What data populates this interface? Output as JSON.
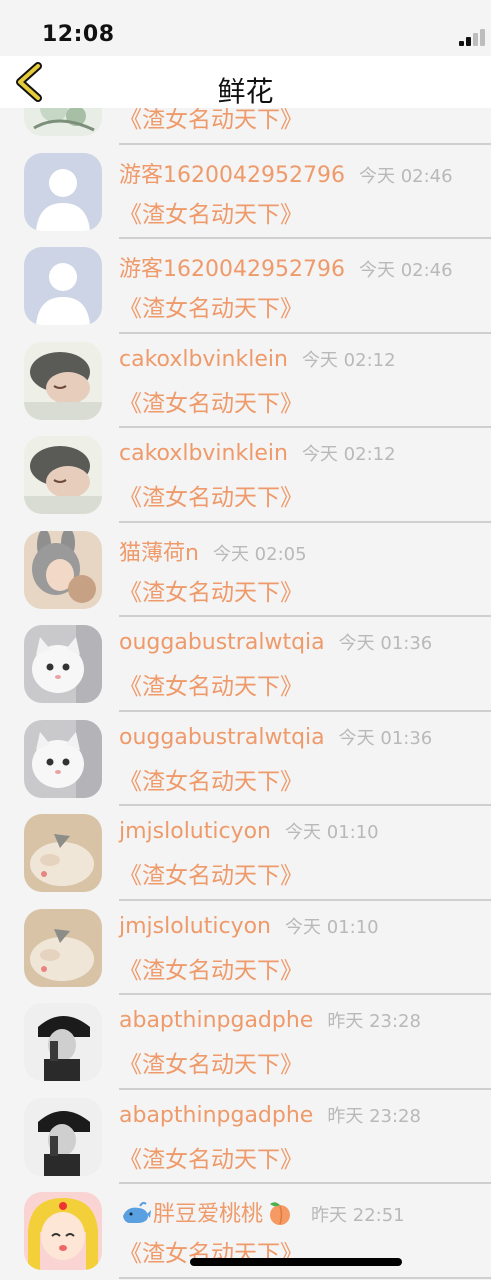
{
  "status_bar": {
    "time": "12:08"
  },
  "nav": {
    "title": "鲜花"
  },
  "rows": [
    {
      "username": "",
      "timestamp": "",
      "message": "《渣女名动天下》",
      "avatar": "blossom"
    },
    {
      "username": "游客1620042952796",
      "timestamp": "今天 02:46",
      "message": "《渣女名动天下》",
      "avatar": "default"
    },
    {
      "username": "游客1620042952796",
      "timestamp": "今天 02:46",
      "message": "《渣女名动天下》",
      "avatar": "default"
    },
    {
      "username": "cakoxlbvinklein",
      "timestamp": "今天 02:12",
      "message": "《渣女名动天下》",
      "avatar": "sleeping-boy"
    },
    {
      "username": "cakoxlbvinklein",
      "timestamp": "今天 02:12",
      "message": "《渣女名动天下》",
      "avatar": "sleeping-boy"
    },
    {
      "username": "猫薄荷n",
      "timestamp": "今天 02:05",
      "message": "《渣女名动天下》",
      "avatar": "bunny-girl"
    },
    {
      "username": "ouggabustralwtqia",
      "timestamp": "今天 01:36",
      "message": "《渣女名动天下》",
      "avatar": "white-cat"
    },
    {
      "username": "ouggabustralwtqia",
      "timestamp": "今天 01:36",
      "message": "《渣女名动天下》",
      "avatar": "white-cat"
    },
    {
      "username": "jmjsloluticyon",
      "timestamp": "今天 01:10",
      "message": "《渣女名动天下》",
      "avatar": "kitten"
    },
    {
      "username": "jmjsloluticyon",
      "timestamp": "今天 01:10",
      "message": "《渣女名动天下》",
      "avatar": "kitten"
    },
    {
      "username": "abapthinpgadphe",
      "timestamp": "昨天 23:28",
      "message": "《渣女名动天下》",
      "avatar": "bw-girl"
    },
    {
      "username": "abapthinpgadphe",
      "timestamp": "昨天 23:28",
      "message": "《渣女名动天下》",
      "avatar": "bw-girl"
    },
    {
      "username": "胖豆爱桃桃",
      "timestamp": "昨天 22:51",
      "message": "《渣女名动天下》",
      "avatar": "anime-girl",
      "prefix_icon": "whale",
      "suffix_icon": "peach"
    }
  ],
  "colors": {
    "accent": "#ef9a6a",
    "timestamp": "#b9b9b9",
    "divider": "#cfcfcf",
    "back_arrow": "#e6cb3a"
  }
}
